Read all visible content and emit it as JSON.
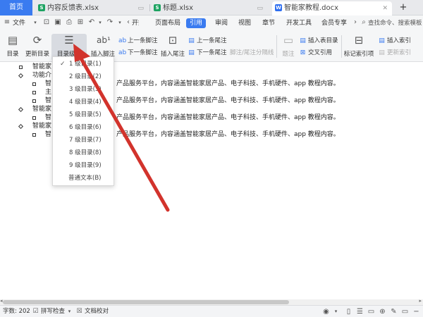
{
  "tabs": {
    "home": "首页",
    "files": [
      {
        "label": "内容反馈表.xlsx",
        "icon": "S",
        "color": "#1ea362"
      },
      {
        "label": "标题.xlsx",
        "icon": "S",
        "color": "#1ea362"
      },
      {
        "label": "智能家教程.docx",
        "icon": "W",
        "color": "#2f6ff0"
      }
    ],
    "add": "+"
  },
  "menu": {
    "file": "文件",
    "items": [
      "页面布局",
      "引用",
      "审阅",
      "视图",
      "章节",
      "开发工具",
      "会员专享"
    ],
    "active_index": 1,
    "start_hint": "开始",
    "search": "查找命令、搜索模板"
  },
  "ribbon": {
    "toc": "目录",
    "update_toc": "更新目录",
    "toc_level": "目录级别",
    "insert_footnote": "插入脚注",
    "prev_footnote": "上一条脚注",
    "next_footnote": "下一条脚注",
    "insert_endnote": "插入尾注",
    "prev_endnote": "上一条尾注",
    "next_endnote": "下一条尾注",
    "footnote_separator": "脚注/尾注分隔线",
    "caption": "题注",
    "insert_table_of_figures": "插入表目录",
    "cross_reference": "交叉引用",
    "mark_index": "标记索引项",
    "insert_index": "插入索引",
    "update_index": "更新索引"
  },
  "document": {
    "lines": [
      {
        "text": "智能家",
        "bullet": "square",
        "indent": 0
      },
      {
        "text": "功能介",
        "bullet": "diamond",
        "indent": 0
      },
      {
        "text": "智",
        "bullet": "square",
        "indent": 1
      },
      {
        "text": "主",
        "bullet": "square",
        "indent": 1
      },
      {
        "text": "智",
        "bullet": "square",
        "indent": 1
      },
      {
        "text": "智能家",
        "bullet": "diamond",
        "indent": 0
      },
      {
        "text": "智",
        "bullet": "square",
        "indent": 1
      },
      {
        "text": "智能家",
        "bullet": "diamond",
        "indent": 0
      },
      {
        "text": "智",
        "bullet": "square",
        "indent": 1
      }
    ],
    "right_text": "产品服务平台，内容涵盖智能家居产品、电子科技、手机硬件、app 教程内容。"
  },
  "dropdown": {
    "items": [
      "1 级目录(1)",
      "2 级目录(2)",
      "3 级目录(3)",
      "4 级目录(4)",
      "5 级目录(5)",
      "6 级目录(6)",
      "7 级目录(7)",
      "8 级目录(8)",
      "9 级目录(9)",
      "普通文本(B)"
    ],
    "checked_index": 0
  },
  "status": {
    "word_count": "字数: 202",
    "spell_check": "拼写检查",
    "proofread": "文档校对"
  },
  "colors": {
    "accent": "#3a7bf0",
    "arrow": "#d2332c"
  }
}
